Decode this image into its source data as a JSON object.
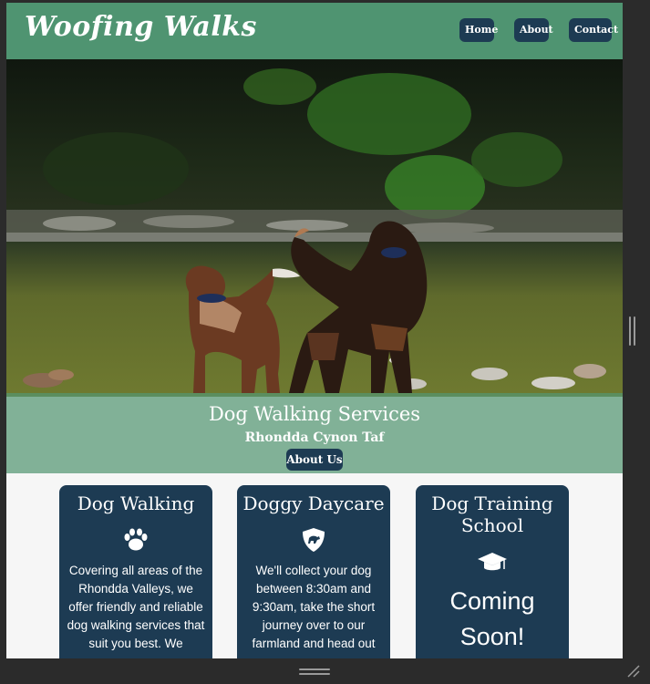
{
  "site": {
    "brand": "Woofing Walks",
    "nav": [
      {
        "label": "Home"
      },
      {
        "label": "About"
      },
      {
        "label": "Contact"
      }
    ]
  },
  "hero": {
    "title": "Dog Walking Services",
    "subtitle": "Rhondda Cynon Taf",
    "button": "About Us"
  },
  "cards": [
    {
      "title": "Dog Walking",
      "icon": "paw-icon",
      "text": "Covering all areas of the Rhondda Valleys, we offer friendly and reliable dog walking services that suit you best. We"
    },
    {
      "title": "Doggy Daycare",
      "icon": "dog-shield-icon",
      "text": "We'll collect your dog between 8:30am and 9:30am, take the short journey over to our farmland and head out"
    },
    {
      "title": "Dog Training School",
      "icon": "graduation-cap-icon",
      "soon": "Coming Soon!"
    }
  ],
  "colors": {
    "navbar": "#4f9471",
    "button": "#1d3b53",
    "card": "#1d3b53",
    "page_background": "#f6f6f6"
  }
}
